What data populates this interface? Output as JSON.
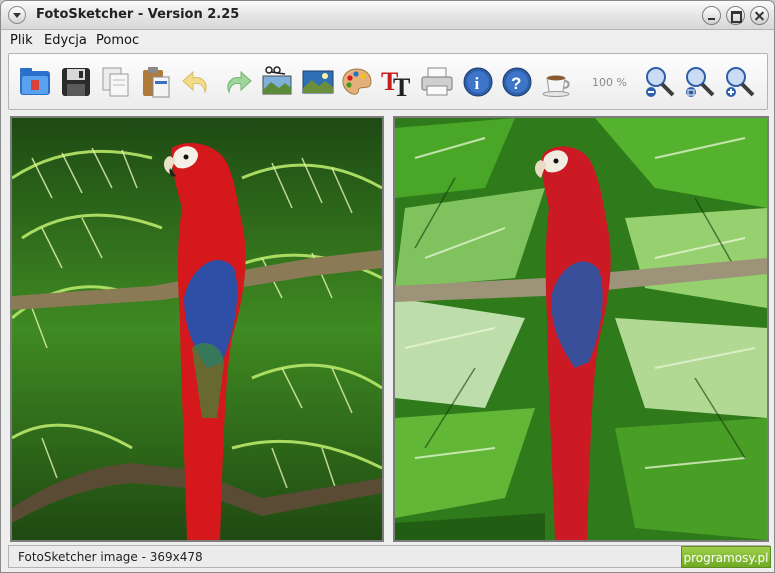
{
  "window": {
    "title": "FotoSketcher - Version 2.25"
  },
  "menu": {
    "items": [
      "Plik",
      "Edycja",
      "Pomoc"
    ]
  },
  "toolbar": {
    "buttons": [
      "open-icon",
      "save-icon",
      "copy-icon",
      "paste-icon",
      "undo-icon",
      "redo-icon",
      "crop-icon",
      "image-icon",
      "palette-icon",
      "text-icon",
      "print-icon",
      "info-icon",
      "help-icon",
      "coffee-icon",
      "zoom-out-icon",
      "zoom-fit-icon",
      "zoom-in-icon"
    ],
    "zoom_label": "100 %"
  },
  "panels": {
    "original": {
      "icon": "parrot-photo"
    },
    "sketch": {
      "icon": "parrot-painting"
    }
  },
  "status": {
    "text": "FotoSketcher image - 369x478"
  },
  "watermark": {
    "text": "programosy.pl"
  },
  "colors": {
    "accent": "#6eaa22",
    "parrot_red": "#d4181c",
    "leaf_green": "#3f9a1e"
  }
}
